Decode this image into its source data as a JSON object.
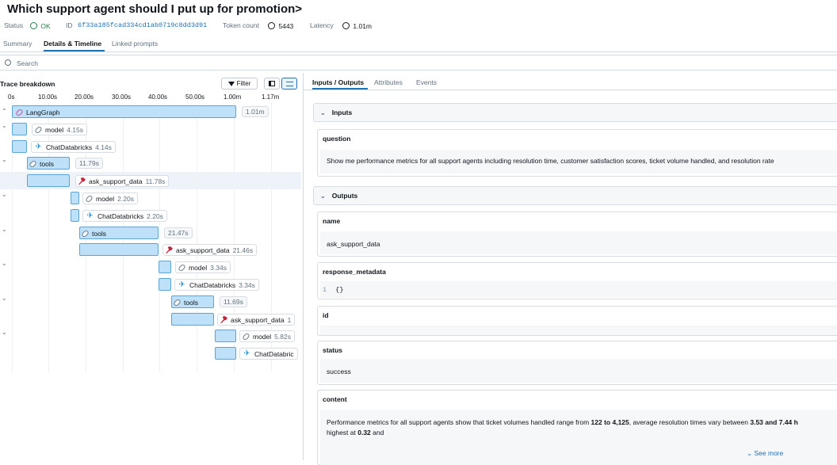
{
  "page_title": "Which support agent should I put up for promotion>",
  "meta": {
    "status_label": "Status",
    "status_value": "OK",
    "id_label": "ID",
    "id_value": "6f33a185fcad334cd1ab0719c8dd3d91",
    "token_label": "Token count",
    "token_value": "5443",
    "latency_label": "Latency",
    "latency_value": "1.01m"
  },
  "tabs": [
    "Summary",
    "Details & Timeline",
    "Linked prompts"
  ],
  "search": {
    "placeholder": "Search"
  },
  "trace": {
    "title": "Trace breakdown",
    "filter_label": "Filter",
    "ticks": [
      "0s",
      "10.00s",
      "20.00s",
      "30.00s",
      "40.00s",
      "50.00s",
      "1.00m",
      "1.17m"
    ],
    "spans": [
      {
        "name": "LangGraph",
        "duration": "1.01m",
        "icon": "langgraph-icon",
        "expandable": true
      },
      {
        "name": "model",
        "duration": "4.15s",
        "icon": "chain-icon",
        "expandable": true
      },
      {
        "name": "ChatDatabricks",
        "duration": "4.14s",
        "icon": "databricks-icon",
        "expandable": false
      },
      {
        "name": "tools",
        "duration": "11.79s",
        "icon": "chain-icon",
        "expandable": true
      },
      {
        "name": "ask_support_data",
        "duration": "11.78s",
        "icon": "tool-icon",
        "expandable": false
      },
      {
        "name": "model",
        "duration": "2.20s",
        "icon": "chain-icon",
        "expandable": true
      },
      {
        "name": "ChatDatabricks",
        "duration": "2.20s",
        "icon": "databricks-icon",
        "expandable": false
      },
      {
        "name": "tools",
        "duration": "21.47s",
        "icon": "chain-icon",
        "expandable": true
      },
      {
        "name": "ask_support_data",
        "duration": "21.46s",
        "icon": "tool-icon",
        "expandable": false
      },
      {
        "name": "model",
        "duration": "3.34s",
        "icon": "chain-icon",
        "expandable": true
      },
      {
        "name": "ChatDatabricks",
        "duration": "3.34s",
        "icon": "databricks-icon",
        "expandable": false
      },
      {
        "name": "tools",
        "duration": "11.69s",
        "icon": "chain-icon",
        "expandable": true
      },
      {
        "name": "ask_support_data",
        "duration": "1",
        "icon": "tool-icon",
        "expandable": false
      },
      {
        "name": "model",
        "duration": "5.82s",
        "icon": "chain-icon",
        "expandable": true
      },
      {
        "name": "ChatDatabric",
        "duration": "",
        "icon": "databricks-icon",
        "expandable": false
      }
    ]
  },
  "right_tabs": [
    "Inputs / Outputs",
    "Attributes",
    "Events"
  ],
  "inputs": {
    "title": "Inputs",
    "question_label": "question",
    "question_value": "Show me performance metrics for all support agents including resolution time, customer satisfaction scores, ticket volume handled, and resolution rate"
  },
  "outputs": {
    "title": "Outputs",
    "name_label": "name",
    "name_value": "ask_support_data",
    "response_metadata_label": "response_metadata",
    "response_metadata_line": "1",
    "response_metadata_value": "{}",
    "id_label": "id",
    "status_label": "status",
    "status_value": "success",
    "content_label": "content",
    "content_parts": {
      "p1": "Performance metrics for all support agents show that ticket volumes handled range from ",
      "b1": "122 to 4,125",
      "p2": ", average resolution times vary between ",
      "b2": "3.53 and 7.44 h",
      "p3": "highest at ",
      "b3": "0.32",
      "p4": " and"
    },
    "see_more": "See more"
  },
  "colors": {
    "accent": "#2272b4",
    "bar_fill": "#bee0f8",
    "bar_border": "#5aa4dc",
    "ok_green": "#277c43",
    "tool_red": "#c8233a",
    "langgraph_pink": "#d13f99"
  }
}
